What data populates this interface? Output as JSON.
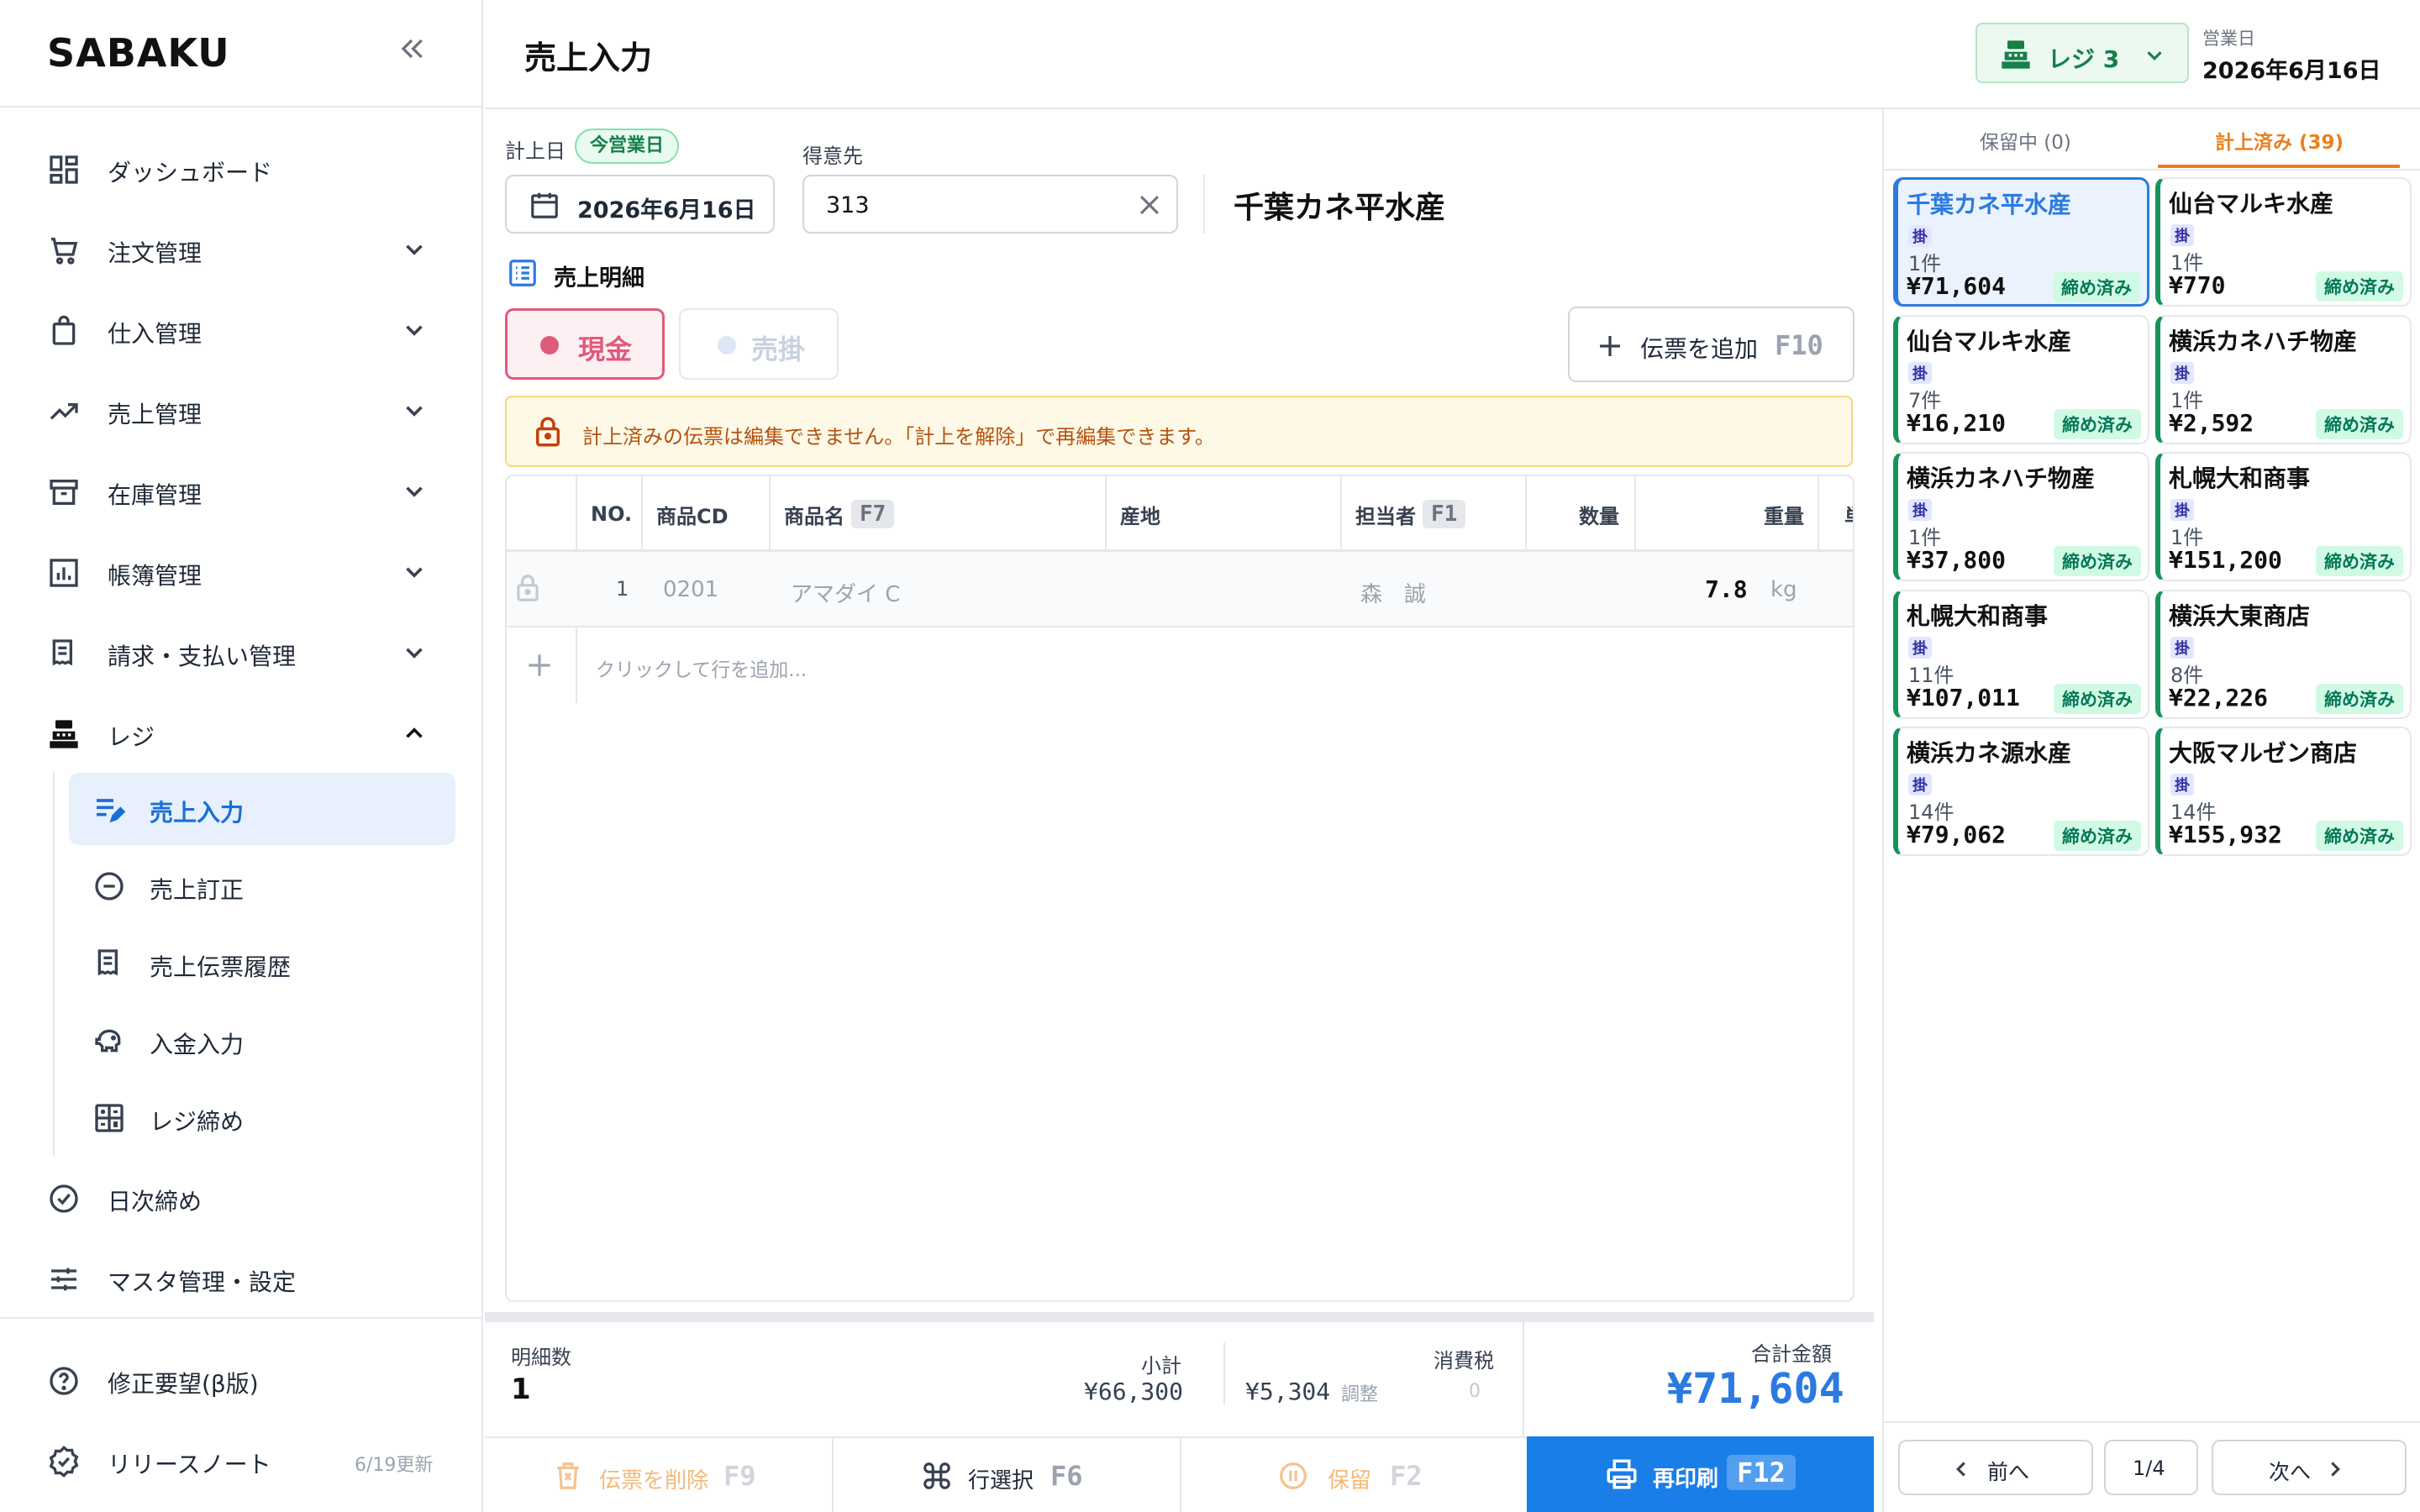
{
  "app": {
    "logo": "SABAKU"
  },
  "sidebar": {
    "items": [
      {
        "label": "ダッシュボード"
      },
      {
        "label": "注文管理"
      },
      {
        "label": "仕入管理"
      },
      {
        "label": "売上管理"
      },
      {
        "label": "在庫管理"
      },
      {
        "label": "帳簿管理"
      },
      {
        "label": "請求・支払い管理"
      },
      {
        "label": "レジ"
      }
    ],
    "sub_items": [
      {
        "label": "売上入力"
      },
      {
        "label": "売上訂正"
      },
      {
        "label": "売上伝票履歴"
      },
      {
        "label": "入金入力"
      },
      {
        "label": "レジ締め"
      }
    ],
    "bottom_items": [
      {
        "label": "日次締め"
      },
      {
        "label": "マスタ管理・設定"
      }
    ],
    "footer": {
      "feedback": "修正要望(β版)",
      "release_notes": "リリースノート",
      "release_updated": "6/19更新"
    }
  },
  "header": {
    "title": "売上入力",
    "register": "レジ 3",
    "business_day_label": "営業日",
    "business_day": "2026年6月16日"
  },
  "form": {
    "date_label": "計上日",
    "today_badge": "今営業日",
    "date_value": "2026年6月16日",
    "customer_label": "得意先",
    "customer_code": "313",
    "customer_name": "千葉カネ平水産",
    "detail_title": "売上明細",
    "cash_label": "現金",
    "credit_label": "売掛",
    "add_slip_label": "伝票を追加",
    "add_slip_key": "F10",
    "lock_notice": "計上済みの伝票は編集できません。「計上を解除」で再編集できます。"
  },
  "table": {
    "headers": {
      "no": "NO.",
      "code": "商品CD",
      "name": "商品名",
      "name_key": "F7",
      "origin": "産地",
      "staff": "担当者",
      "staff_key": "F1",
      "qty": "数量",
      "weight": "重量",
      "cut": "単"
    },
    "rows": [
      {
        "no": "1",
        "code": "0201",
        "name": "アマダイ C",
        "origin": "",
        "staff": "森　誠",
        "qty": "",
        "weight": "7.8",
        "unit": "kg"
      }
    ],
    "add_row_hint": "クリックして行を追加..."
  },
  "summary": {
    "count_label": "明細数",
    "count": "1",
    "subtotal_label": "小計",
    "subtotal": "¥66,300",
    "tax_label": "消費税",
    "tax": "¥5,304",
    "adjust_label": "調整",
    "adjust": "0",
    "total_label": "合計金額",
    "total": "¥71,604"
  },
  "footer_actions": {
    "delete": "伝票を削除",
    "delete_key": "F9",
    "select": "行選択",
    "select_key": "F6",
    "hold": "保留",
    "hold_key": "F2",
    "reprint": "再印刷",
    "reprint_key": "F12"
  },
  "right_panel": {
    "tab_hold": "保留中 (0)",
    "tab_posted": "計上済み (39)",
    "cards": [
      {
        "name": "千葉カネ平水産",
        "tag": "掛",
        "count": "1件",
        "amount": "¥71,604",
        "status": "締め済み"
      },
      {
        "name": "仙台マルキ水産",
        "tag": "掛",
        "count": "1件",
        "amount": "¥770",
        "status": "締め済み"
      },
      {
        "name": "仙台マルキ水産",
        "tag": "掛",
        "count": "7件",
        "amount": "¥16,210",
        "status": "締め済み"
      },
      {
        "name": "横浜カネハチ物産",
        "tag": "掛",
        "count": "1件",
        "amount": "¥2,592",
        "status": "締め済み"
      },
      {
        "name": "横浜カネハチ物産",
        "tag": "掛",
        "count": "1件",
        "amount": "¥37,800",
        "status": "締め済み"
      },
      {
        "name": "札幌大和商事",
        "tag": "掛",
        "count": "1件",
        "amount": "¥151,200",
        "status": "締め済み"
      },
      {
        "name": "札幌大和商事",
        "tag": "掛",
        "count": "11件",
        "amount": "¥107,011",
        "status": "締め済み"
      },
      {
        "name": "横浜大東商店",
        "tag": "掛",
        "count": "8件",
        "amount": "¥22,226",
        "status": "締め済み"
      },
      {
        "name": "横浜カネ源水産",
        "tag": "掛",
        "count": "14件",
        "amount": "¥79,062",
        "status": "締め済み"
      },
      {
        "name": "大阪マルゼン商店",
        "tag": "掛",
        "count": "14件",
        "amount": "¥155,932",
        "status": "締め済み"
      }
    ],
    "prev": "前へ",
    "page": "1/4",
    "next": "次へ"
  },
  "colors": {
    "accent": "#2b7ae0",
    "cash": "#e05a7a",
    "posted_tab": "#e8801f",
    "closed": "#047857"
  }
}
